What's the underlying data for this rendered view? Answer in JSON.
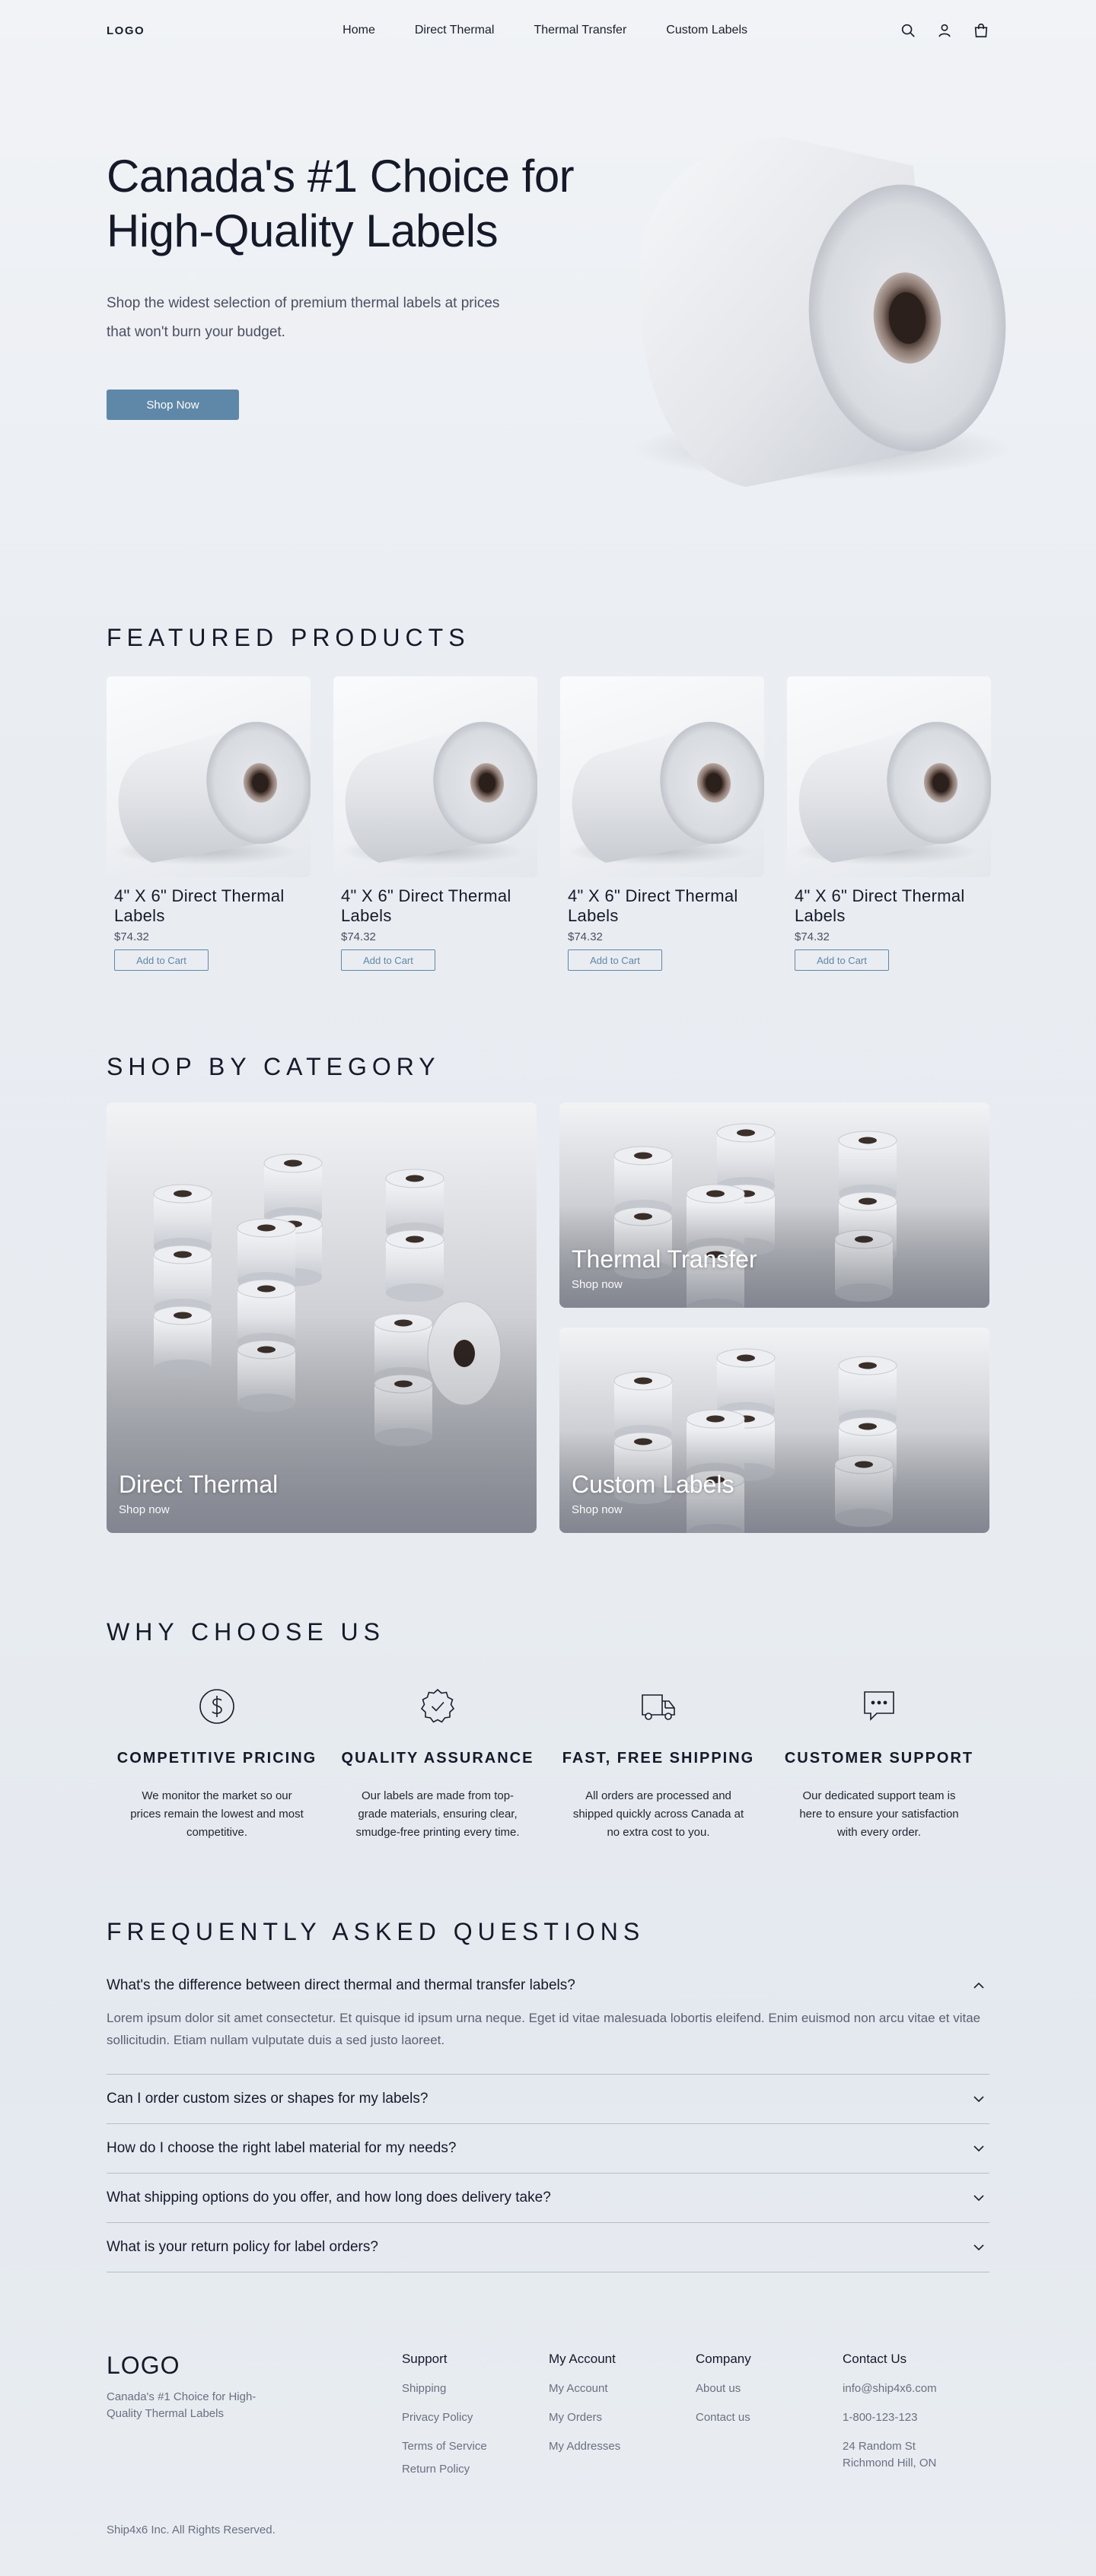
{
  "nav": {
    "logo": "LOGO",
    "links": [
      "Home",
      "Direct Thermal",
      "Thermal Transfer",
      "Custom Labels"
    ]
  },
  "icons": {
    "search": "search-icon",
    "account": "user-icon",
    "cart": "shopping-bag-icon"
  },
  "hero": {
    "title_line1": "Canada's #1 Choice for",
    "title_line2": "High-Quality Labels",
    "subtitle": "Shop the widest selection of premium thermal labels at prices that won't burn your budget.",
    "cta": "Shop Now"
  },
  "featured": {
    "title": "FEATURED PRODUCTS",
    "products": [
      {
        "name": "4\" X 6\" Direct Thermal Labels",
        "price": "$74.32",
        "cta": "Add to Cart"
      },
      {
        "name": "4\" X 6\" Direct Thermal Labels",
        "price": "$74.32",
        "cta": "Add to Cart"
      },
      {
        "name": "4\" X 6\" Direct Thermal Labels",
        "price": "$74.32",
        "cta": "Add to Cart"
      },
      {
        "name": "4\" X 6\" Direct Thermal Labels",
        "price": "$74.32",
        "cta": "Add to Cart"
      }
    ]
  },
  "category": {
    "title": "SHOP BY CATEGORY",
    "items": [
      {
        "title": "Direct Thermal",
        "cta": "Shop now"
      },
      {
        "title": "Thermal Transfer",
        "cta": "Shop now"
      },
      {
        "title": "Custom Labels",
        "cta": "Shop now"
      }
    ]
  },
  "why": {
    "title": "WHY CHOOSE US",
    "features": [
      {
        "icon": "dollar-icon",
        "title": "COMPETITIVE PRICING",
        "desc": "We monitor the market so our prices remain the lowest and most competitive."
      },
      {
        "icon": "badge-check-icon",
        "title": "QUALITY ASSURANCE",
        "desc": "Our labels are made from top-grade materials, ensuring clear, smudge-free printing every time."
      },
      {
        "icon": "truck-icon",
        "title": "FAST, FREE SHIPPING",
        "desc": "All orders are processed and shipped quickly across Canada at no extra cost to you."
      },
      {
        "icon": "chat-icon",
        "title": "CUSTOMER SUPPORT",
        "desc": "Our dedicated support team is here to ensure your satisfaction with every order."
      }
    ]
  },
  "faq": {
    "title": "FREQUENTLY ASKED QUESTIONS",
    "items": [
      {
        "q": "What's the difference between direct thermal and thermal transfer labels?",
        "a": "Lorem ipsum dolor sit amet consectetur. Et quisque id ipsum urna neque. Eget id vitae malesuada lobortis eleifend. Enim euismod non arcu vitae et vitae sollicitudin. Etiam nullam vulputate duis a sed justo laoreet.",
        "open": true
      },
      {
        "q": "Can I order custom sizes or shapes for my labels?",
        "open": false
      },
      {
        "q": "How do I choose the right label material for my needs?",
        "open": false
      },
      {
        "q": "What shipping options do you offer, and how long does delivery take?",
        "open": false
      },
      {
        "q": "What is your return policy for label orders?",
        "open": false
      }
    ]
  },
  "footer": {
    "logo": "LOGO",
    "tagline": "Canada's #1 Choice for High-Quality Thermal Labels",
    "support": {
      "title": "Support",
      "links": [
        "Shipping",
        "Privacy Policy",
        "Terms of Service",
        "Return Policy"
      ]
    },
    "account": {
      "title": "My Account",
      "links": [
        "My Account",
        "My Orders",
        "My Addresses"
      ]
    },
    "company": {
      "title": "Company",
      "links": [
        "About us",
        "Contact us"
      ]
    },
    "contact": {
      "title": "Contact Us",
      "email": "info@ship4x6.com",
      "phone": "1-800-123-123",
      "address_line1": "24 Random St",
      "address_line2": "Richmond Hill, ON"
    },
    "copyright": "Ship4x6 Inc. All Rights Reserved."
  }
}
